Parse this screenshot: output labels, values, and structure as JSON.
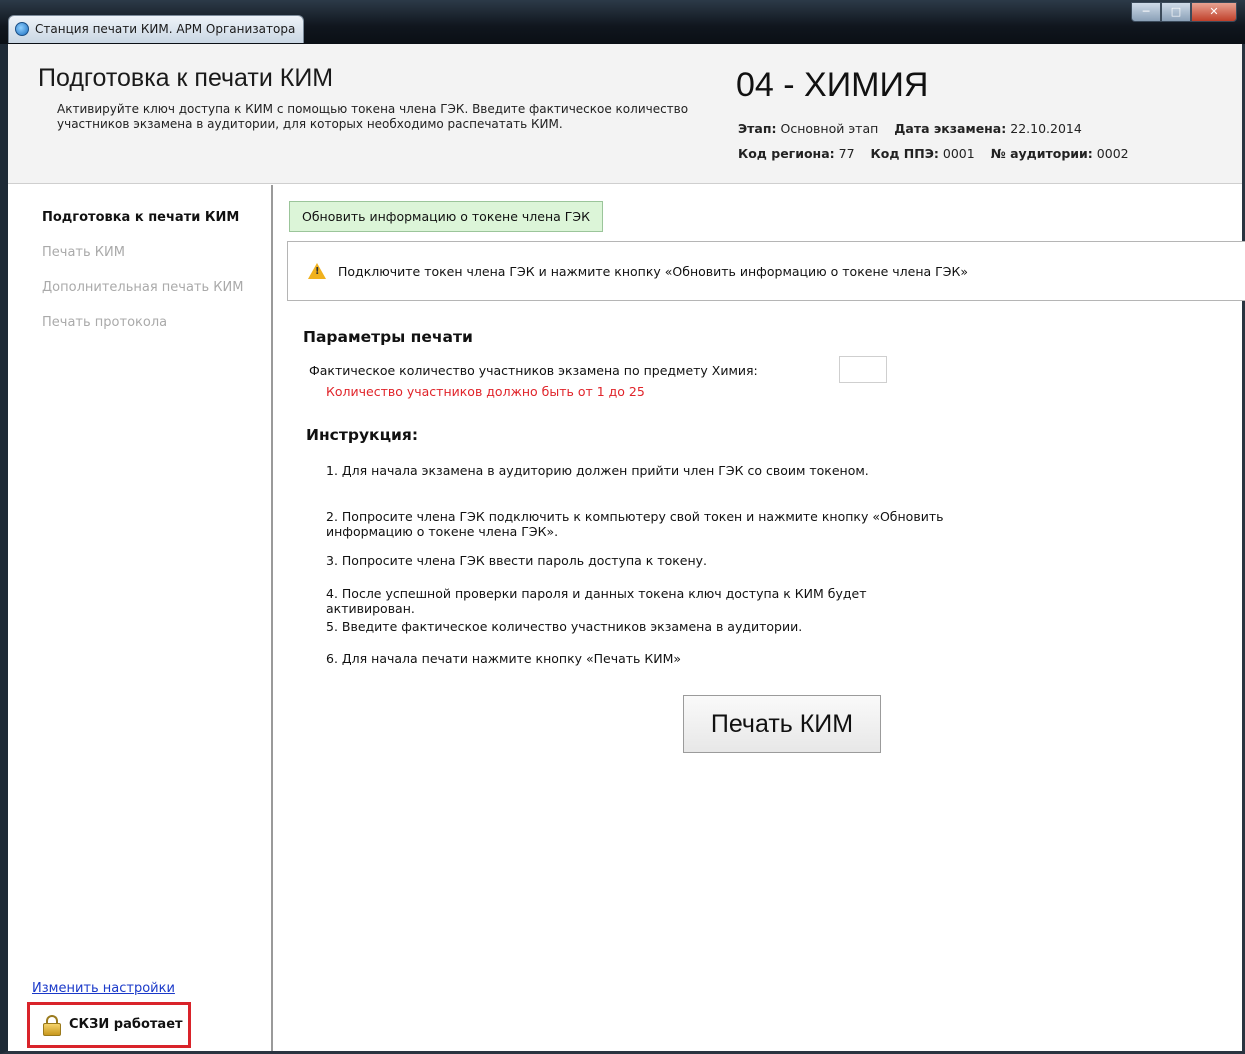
{
  "window": {
    "title": "Станция печати КИМ. АРМ Организатора"
  },
  "header": {
    "title": "Подготовка к печати КИМ",
    "description": "Активируйте ключ доступа к КИМ с помощью токена члена ГЭК. Введите фактическое количество участников экзамена в аудитории, для которых необходимо распечатать КИМ.",
    "subject": "04 - ХИМИЯ",
    "stage_label": "Этап:",
    "stage_value": "Основной этап",
    "date_label": "Дата экзамена:",
    "date_value": "22.10.2014",
    "region_label": "Код региона:",
    "region_value": "77",
    "ppe_label": "Код ППЭ:",
    "ppe_value": "0001",
    "room_label": "№ аудитории:",
    "room_value": "0002"
  },
  "sidebar": {
    "items": [
      {
        "label": "Подготовка к печати КИМ",
        "active": true
      },
      {
        "label": "Печать КИМ",
        "active": false
      },
      {
        "label": "Дополнительная печать КИМ",
        "active": false
      },
      {
        "label": "Печать протокола",
        "active": false
      }
    ],
    "settings_link": "Изменить настройки",
    "skzi_status": "СКЗИ работает",
    "lock_icon": "lock-icon"
  },
  "main": {
    "refresh_button": "Обновить информацию о токене члена ГЭК",
    "warning_text": "Подключите токен члена ГЭК и нажмите кнопку «Обновить информацию о токене члена ГЭК»",
    "warning_icon": "warning-icon",
    "params_heading": "Параметры печати",
    "param_label": "Фактическое количество участников экзамена по предмету Химия:",
    "param_value": "",
    "param_error": "Количество участников должно быть от 1 до 25",
    "instructions_heading": "Инструкция:",
    "instructions": [
      "1. Для начала экзамена в аудиторию должен прийти член ГЭК со своим токеном.",
      "2. Попросите члена ГЭК подключить к компьютеру свой токен и нажмите кнопку «Обновить информацию о токене члена ГЭК».",
      "3. Попросите члена ГЭК ввести пароль доступа к токену.",
      "4. После успешной проверки пароля и данных токена ключ доступа к КИМ будет активирован.",
      "5. Введите фактическое количество участников экзамена в аудитории.",
      "6. Для начала печати нажмите кнопку «Печать КИМ»"
    ],
    "print_button": "Печать КИМ"
  },
  "colors": {
    "error": "#e0242a",
    "link": "#1a39c9",
    "refresh_bg": "#dcf5d8",
    "highlight_border": "#d9232a"
  }
}
